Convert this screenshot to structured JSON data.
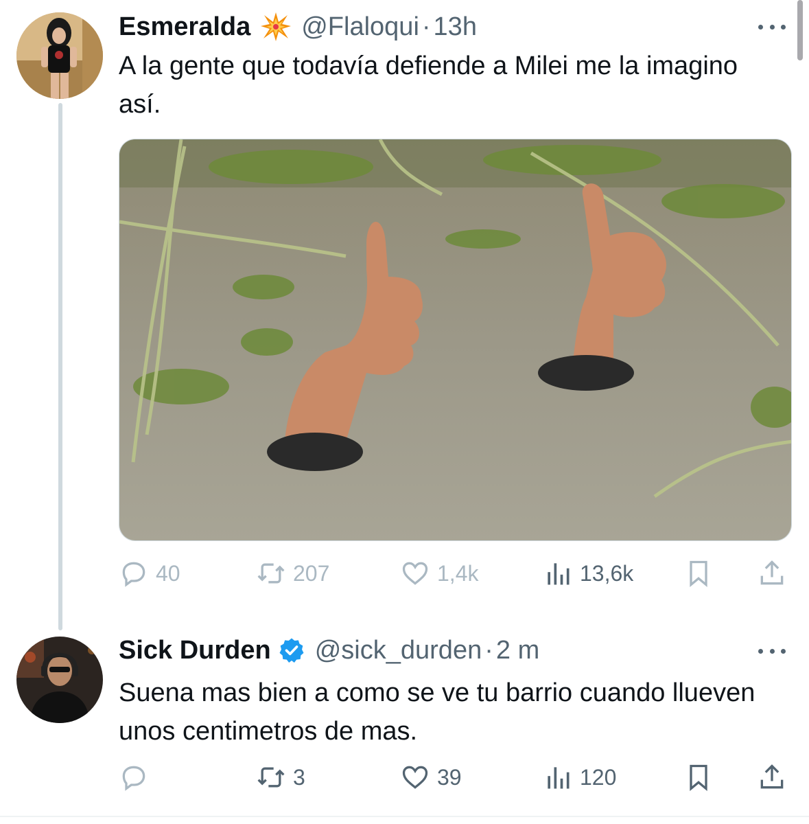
{
  "tweets": [
    {
      "display_name": "Esmeralda",
      "badge_icon": "collision-emoji-icon",
      "handle": "@Flaloqui",
      "separator": "·",
      "time": "13h",
      "text": "A la gente que todavía defiende a Milei me la imagino así.",
      "has_media": true,
      "actions": {
        "replies": "40",
        "retweets": "207",
        "likes": "1,4k",
        "views": "13,6k"
      }
    },
    {
      "display_name": "Sick Durden",
      "badge_icon": "verified-badge-icon",
      "handle": "@sick_durden",
      "separator": "·",
      "time": "2 m",
      "text": "Suena mas bien a como se ve tu barrio cuando llueven unos centimetros de mas.",
      "has_media": false,
      "actions": {
        "replies": "",
        "retweets": "3",
        "likes": "39",
        "views": "120"
      }
    }
  ],
  "colors": {
    "text_primary": "#0f1419",
    "text_secondary": "#536471",
    "verified_blue": "#1d9bf0",
    "thread_line": "#cfd9de"
  }
}
